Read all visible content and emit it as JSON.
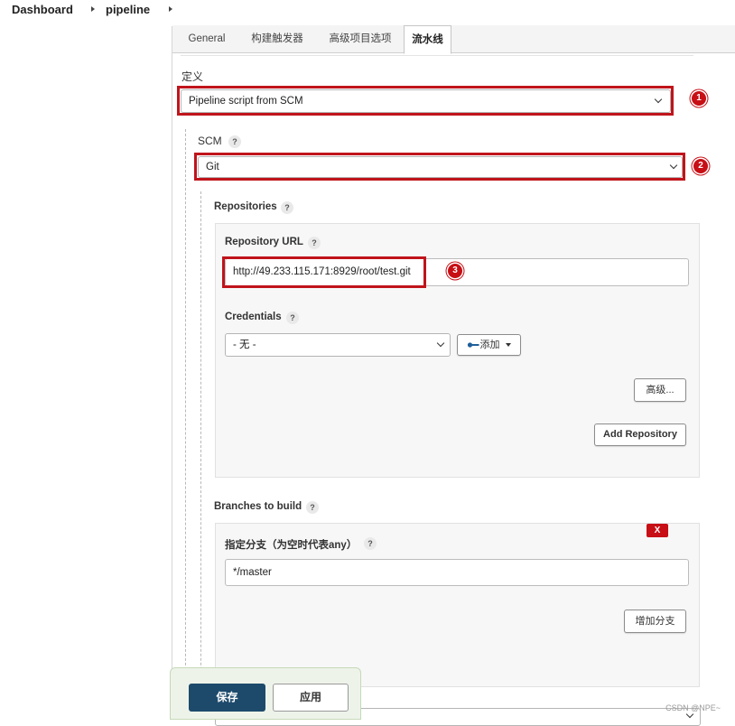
{
  "breadcrumb": {
    "items": [
      "Dashboard",
      "pipeline"
    ]
  },
  "tabs": [
    {
      "label": "General"
    },
    {
      "label": "构建触发器"
    },
    {
      "label": "高级项目选项"
    },
    {
      "label": "流水线"
    }
  ],
  "definition": {
    "label": "定义",
    "selected": "Pipeline script from SCM"
  },
  "scm": {
    "label": "SCM",
    "selected": "Git"
  },
  "repositories": {
    "label": "Repositories",
    "url_label": "Repository URL",
    "url_value": "http://49.233.115.171:8929/root/test.git",
    "credentials_label": "Credentials",
    "credentials_selected": "- 无 -",
    "add_label": "添加",
    "advanced_label": "高级...",
    "add_repository_label": "Add Repository"
  },
  "branches": {
    "label": "Branches to build",
    "delete_label": "X",
    "specifier_label": "指定分支（为空时代表any）",
    "specifier_value": "*/master",
    "add_branch_label": "增加分支"
  },
  "help_mark": "?",
  "annotations": [
    "1",
    "2",
    "3"
  ],
  "bottom_bar": {
    "save_label": "保存",
    "apply_label": "应用"
  },
  "watermark": "CSDN @NPE~",
  "colors": {
    "annotation_red": "#c0141b",
    "save_button": "#1d4a6b",
    "delete_button": "#c70f15"
  }
}
